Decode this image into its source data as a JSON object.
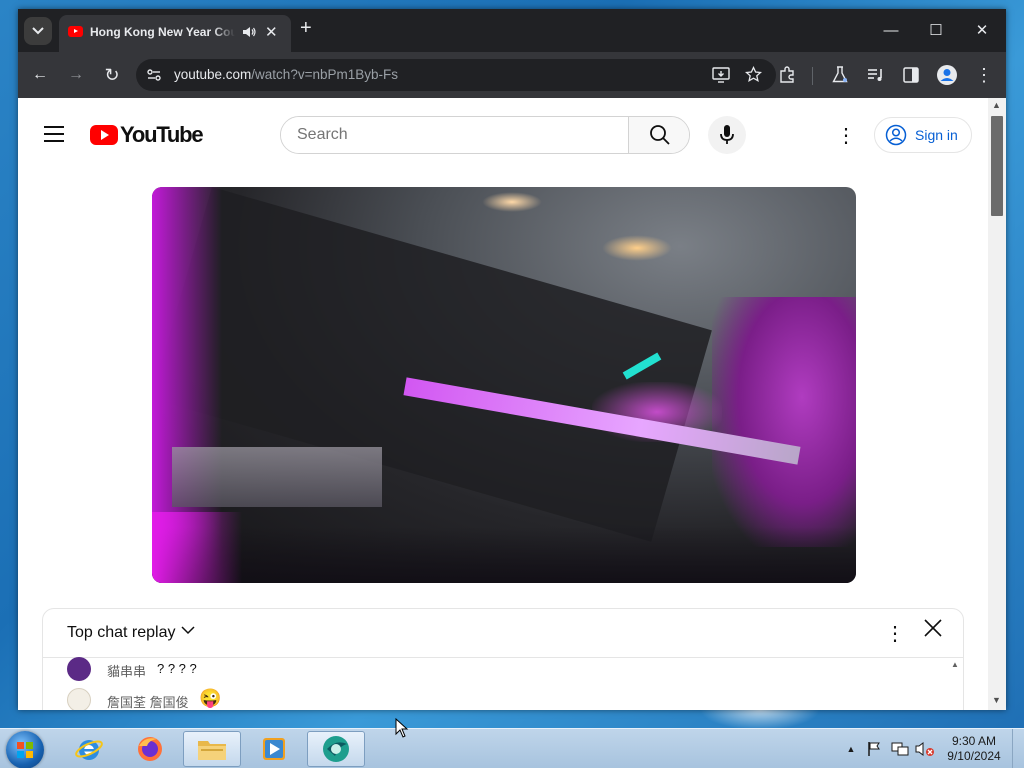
{
  "browser": {
    "tab": {
      "title": "Hong Kong New Year Countdown",
      "favicon": "youtube-favicon-icon",
      "audio_icon": "speaker-icon",
      "close_label": "✕"
    },
    "new_tab_label": "+",
    "window_controls": {
      "minimize": "—",
      "maximize": "☐",
      "close": "✕"
    },
    "toolbar": {
      "back": "←",
      "forward": "→",
      "reload": "↻",
      "url_host": "youtube.com",
      "url_path": "/watch?v=nbPm1Byb-Fs"
    }
  },
  "youtube": {
    "logo_text": "YouTube",
    "search_placeholder": "Search",
    "sign_in_label": "Sign in",
    "more_label": "⋮"
  },
  "chat": {
    "title": "Top chat replay",
    "chevron": "⌵",
    "more_label": "⋮",
    "close_label": "✕",
    "messages": [
      {
        "author": "貓串串",
        "text": "? ? ? ?",
        "avatar_color": "#5b2a86"
      },
      {
        "author": "詹国荃 詹国俊",
        "text": "😜",
        "avatar_color": "#f3efe6"
      }
    ]
  },
  "taskbar": {
    "apps": [
      {
        "name": "internet-explorer",
        "active": false
      },
      {
        "name": "firefox",
        "active": false
      },
      {
        "name": "file-explorer",
        "active": true
      },
      {
        "name": "media-player",
        "active": false
      },
      {
        "name": "chrome-app",
        "active": true
      }
    ],
    "clock": {
      "time": "9:30 AM",
      "date": "9/10/2024"
    }
  },
  "colors": {
    "chrome_dark": "#202124",
    "chrome_toolbar": "#35363a",
    "youtube_red": "#ff0000",
    "sign_in_blue": "#065fd4"
  }
}
